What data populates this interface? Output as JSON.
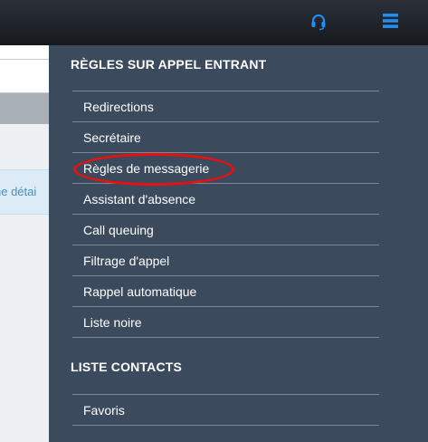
{
  "header": {
    "support_icon": "headset-icon",
    "menu_icon": "hamburger-menu-icon",
    "accent_color": "#1e90ff"
  },
  "background_page": {
    "info_text": "he détai"
  },
  "menu": {
    "sections": [
      {
        "title": "RÈGLES SUR APPEL ENTRANT",
        "items": [
          {
            "label": "Redirections"
          },
          {
            "label": "Secrétaire"
          },
          {
            "label": "Règles de messagerie",
            "highlighted": true
          },
          {
            "label": "Assistant d'absence"
          },
          {
            "label": "Call queuing"
          },
          {
            "label": "Filtrage d'appel"
          },
          {
            "label": "Rappel automatique"
          },
          {
            "label": "Liste noire"
          }
        ]
      },
      {
        "title": "LISTE CONTACTS",
        "items": [
          {
            "label": "Favoris"
          }
        ]
      }
    ],
    "highlight_color": "#e81010"
  }
}
